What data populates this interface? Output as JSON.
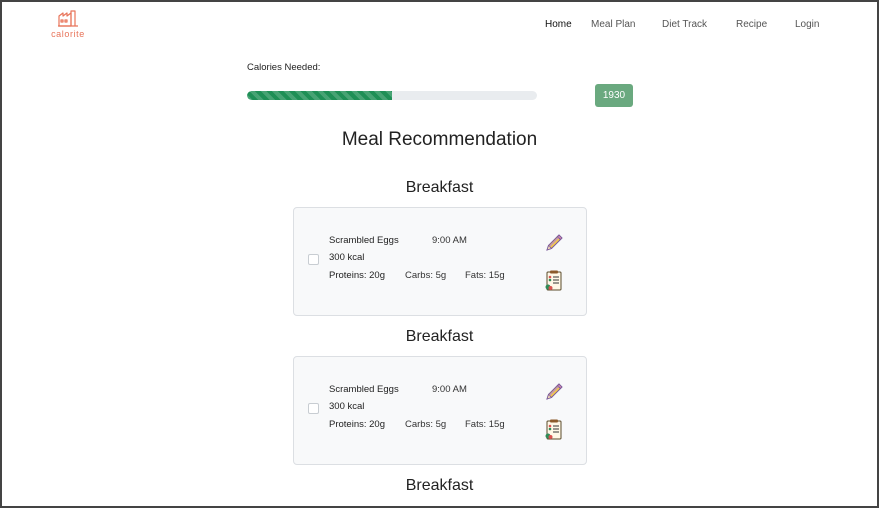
{
  "app": {
    "logo_text": "calorite"
  },
  "nav": {
    "items": [
      {
        "label": "Home"
      },
      {
        "label": "Meal Plan"
      },
      {
        "label": "Diet Track"
      },
      {
        "label": "Recipe"
      },
      {
        "label": "Login"
      }
    ],
    "active": "Home"
  },
  "calories": {
    "label": "Calories Needed:",
    "value": "1930",
    "progress_fraction": 0.5
  },
  "section": {
    "title": "Meal Recommendation"
  },
  "meals": [
    {
      "heading": "Breakfast",
      "name": "Scrambled Eggs",
      "time": "9:00 AM",
      "kcal": "300 kcal",
      "proteins": "Proteins: 20g",
      "carbs": "Carbs: 5g",
      "fats": "Fats: 15g",
      "checked": false
    },
    {
      "heading": "Breakfast",
      "name": "Scrambled Eggs",
      "time": "9:00 AM",
      "kcal": "300 kcal",
      "proteins": "Proteins: 20g",
      "carbs": "Carbs: 5g",
      "fats": "Fats: 15g",
      "checked": false
    },
    {
      "heading": "Breakfast"
    }
  ],
  "colors": {
    "brand": "#e8745a",
    "progress": "#1f8f56",
    "badge": "#6aa97f",
    "card_bg": "#f8f9fa"
  },
  "icons": {
    "logo": "factory-logo-icon",
    "edit": "pencil-icon",
    "recipe": "recipe-card-icon"
  }
}
